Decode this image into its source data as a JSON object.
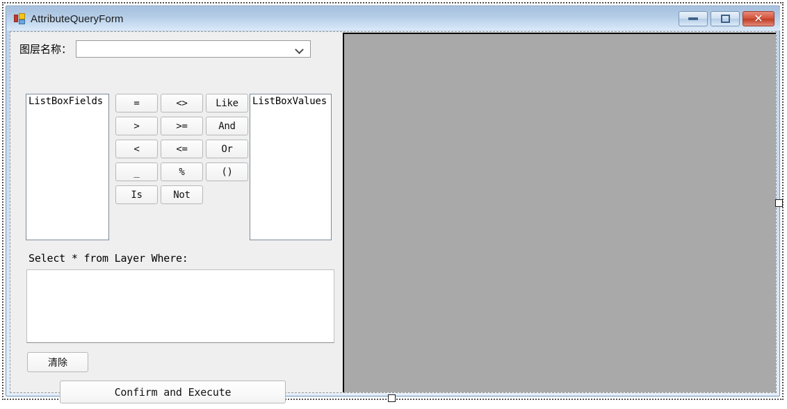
{
  "window": {
    "title": "AttributeQueryForm",
    "icon": "visual-studio-form-icon",
    "buttons": {
      "minimize": "—",
      "maximize": "□",
      "close": "✕"
    }
  },
  "form": {
    "layer": {
      "label": "图层名称：",
      "combo_value": "",
      "combo_placeholder": "",
      "arrow_icon": "chevron-down-icon"
    },
    "listbox_fields": {
      "title": "ListBoxFields",
      "items": [
        "ListBoxFields"
      ]
    },
    "listbox_values": {
      "title": "ListBoxValues",
      "items": [
        "ListBoxValues"
      ]
    },
    "operators": [
      {
        "label": "=",
        "name": "equals"
      },
      {
        "label": "<>",
        "name": "not-equals"
      },
      {
        "label": "Like",
        "name": "like"
      },
      {
        "label": ">",
        "name": "greater-than"
      },
      {
        "label": ">=",
        "name": "greater-or-equal"
      },
      {
        "label": "And",
        "name": "and"
      },
      {
        "label": "<",
        "name": "less-than"
      },
      {
        "label": "<=",
        "name": "less-or-equal"
      },
      {
        "label": "Or",
        "name": "or"
      },
      {
        "label": "_",
        "name": "underscore-wildcard"
      },
      {
        "label": "%",
        "name": "percent-wildcard"
      },
      {
        "label": "()",
        "name": "parentheses"
      },
      {
        "label": "Is",
        "name": "is"
      },
      {
        "label": "Not",
        "name": "not"
      },
      {
        "label": "",
        "name": "empty-slot"
      }
    ],
    "sql_label": "Select * from Layer Where:",
    "sql_textbox": {
      "value": "",
      "placeholder": ""
    },
    "clear_button": "清除",
    "confirm_button": "Confirm and Execute"
  },
  "map_panel": {
    "label": "map-display-panel",
    "background_color": "#a9a9a9"
  },
  "colors": {
    "title_bar_top": "#a5c0de",
    "title_bar_bottom": "#dce9f8",
    "close_button": "#c03f27",
    "client_background": "#efefef",
    "map_background": "#a9a9a9",
    "window_border": "#6d93bb"
  }
}
